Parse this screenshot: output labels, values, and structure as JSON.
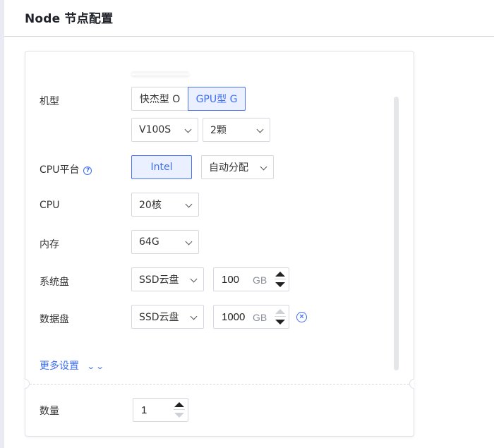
{
  "header": {
    "title": "Node 节点配置"
  },
  "form": {
    "instance_type": {
      "label": "机型",
      "options": [
        "快杰型 O",
        "GPU型 G"
      ],
      "selected": "GPU型 G",
      "gpu_model": "V100S",
      "gpu_count": "2颗"
    },
    "cpu_platform": {
      "label": "CPU平台",
      "help_icon": "help-circle-icon",
      "help_glyph": "?",
      "option": "Intel",
      "allocation": "自动分配"
    },
    "cpu": {
      "label": "CPU",
      "value": "20核"
    },
    "memory": {
      "label": "内存",
      "value": "64G"
    },
    "system_disk": {
      "label": "系统盘",
      "type": "SSD云盘",
      "size": "100",
      "unit": "GB"
    },
    "data_disk": {
      "label": "数据盘",
      "type": "SSD云盘",
      "size": "1000",
      "unit": "GB",
      "remove_icon": "close-circle-icon",
      "remove_glyph": "×"
    },
    "more_settings": {
      "label": "更多设置",
      "icon": "double-chevron-down-icon",
      "glyph": "⌄⌄"
    },
    "quantity": {
      "label": "数量",
      "value": "1"
    }
  },
  "colors": {
    "accent": "#3e6ef2",
    "border": "#d5d8de",
    "active_bg": "#eaf0ff"
  }
}
